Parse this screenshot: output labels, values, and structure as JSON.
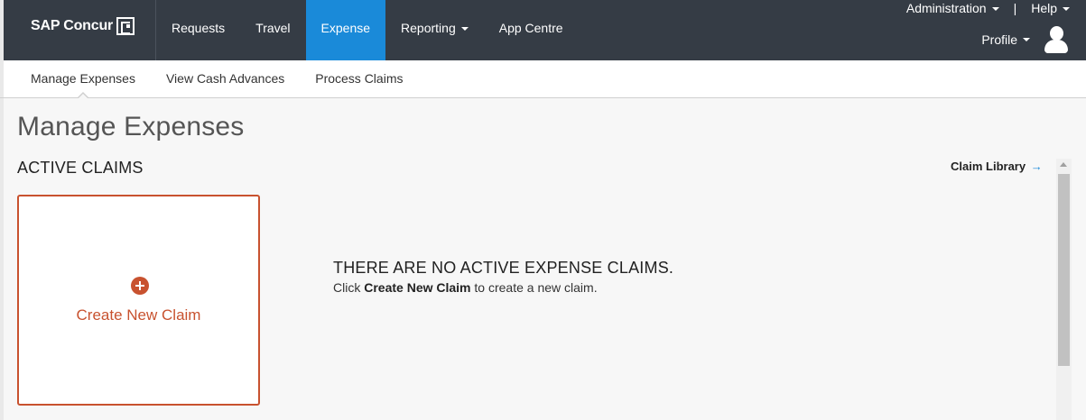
{
  "brand": {
    "name": "SAP Concur",
    "logo_icon": "concur-c-icon"
  },
  "nav": {
    "items": [
      {
        "label": "Requests",
        "active": false,
        "dropdown": false
      },
      {
        "label": "Travel",
        "active": false,
        "dropdown": false
      },
      {
        "label": "Expense",
        "active": true,
        "dropdown": false
      },
      {
        "label": "Reporting",
        "active": false,
        "dropdown": true
      },
      {
        "label": "App Centre",
        "active": false,
        "dropdown": false
      }
    ],
    "active_color": "#1a8ad9",
    "bar_color": "#353c45"
  },
  "utility": {
    "administration": "Administration",
    "separator": "|",
    "help": "Help",
    "profile": "Profile"
  },
  "subnav": {
    "items": [
      {
        "label": "Manage Expenses",
        "active": true
      },
      {
        "label": "View Cash Advances",
        "active": false
      },
      {
        "label": "Process Claims",
        "active": false
      }
    ]
  },
  "page": {
    "title": "Manage Expenses",
    "section_title": "ACTIVE CLAIMS",
    "claim_library": "Claim Library",
    "claim_library_arrow": "→",
    "create_card": {
      "label": "Create New Claim",
      "accent": "#c8522f"
    },
    "empty_state": {
      "title": "THERE ARE NO ACTIVE EXPENSE CLAIMS.",
      "text_prefix": "Click ",
      "text_bold": "Create New Claim",
      "text_suffix": " to create a new claim."
    }
  }
}
